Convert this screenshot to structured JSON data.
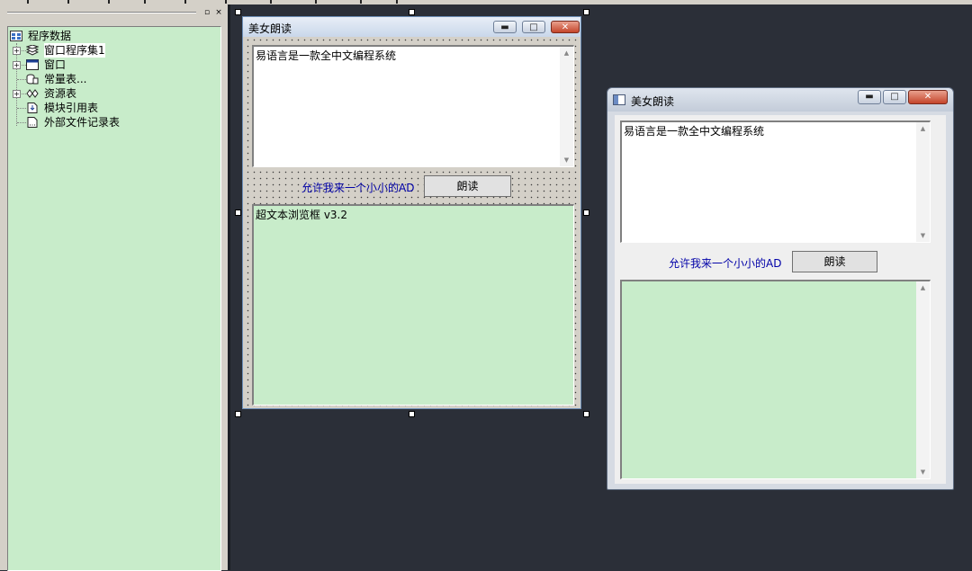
{
  "tree": {
    "root": "程序数据",
    "items": [
      {
        "label": "窗口程序集1",
        "icon": "class-module-icon",
        "expandable": true
      },
      {
        "label": "窗口",
        "icon": "window-icon",
        "expandable": true
      },
      {
        "label": "常量表...",
        "icon": "constant-table-icon",
        "expandable": false
      },
      {
        "label": "资源表",
        "icon": "resource-table-icon",
        "expandable": true
      },
      {
        "label": "模块引用表",
        "icon": "module-reference-icon",
        "expandable": false
      },
      {
        "label": "外部文件记录表",
        "icon": "external-file-icon",
        "expandable": false
      }
    ],
    "panel_buttons": {
      "restore": "▫",
      "close": "×"
    }
  },
  "design_window": {
    "title": "美女朗读",
    "caption_buttons": {
      "minimize": "▬",
      "maximize": "□",
      "close": "✕"
    },
    "text_box": "易语言是一款全中文编程系统",
    "ad_label": "允许我来一个小小的AD",
    "read_button": "朗读",
    "browser_label": "超文本浏览框 v3.2"
  },
  "run_window": {
    "title": "美女朗读",
    "caption_buttons": {
      "minimize": "▬",
      "maximize": "□",
      "close": "✕"
    },
    "text_box": "易语言是一款全中文编程系统",
    "ad_label": "允许我来一个小小的AD",
    "read_button": "朗读"
  },
  "colors": {
    "background": "#2b2f38",
    "tree_bg": "#c8ecca",
    "ad_text": "#0000a8",
    "close_button": "#c4452b"
  }
}
